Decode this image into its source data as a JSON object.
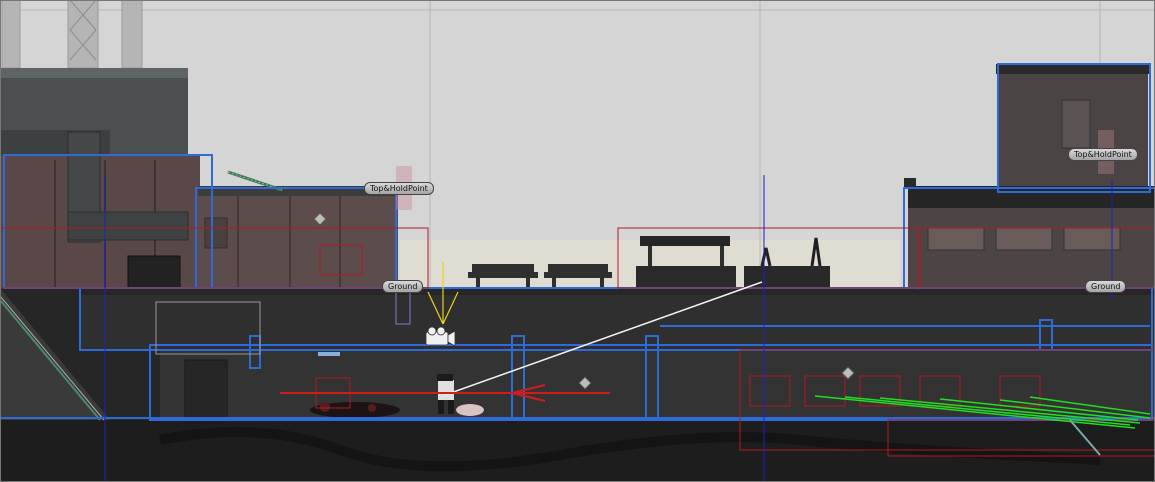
{
  "scene": {
    "gizmo_labels": {
      "top_hold_point_left": "Top&HoldPoint",
      "top_hold_point_right": "Top&HoldPoint",
      "ground_left": "Ground",
      "ground_right": "Ground"
    },
    "colors": {
      "sky": "#d4d4d4",
      "collider_outline": "#2e6bd6",
      "trigger_outline": "#b01a22",
      "raycast_green": "#22dd22",
      "camera_frustum": "#e8d21a",
      "aim_line": "#ffffff",
      "axis_line": "#2020c0"
    },
    "icons": [
      "camera-icon",
      "waypoint-diamond-icon"
    ]
  }
}
